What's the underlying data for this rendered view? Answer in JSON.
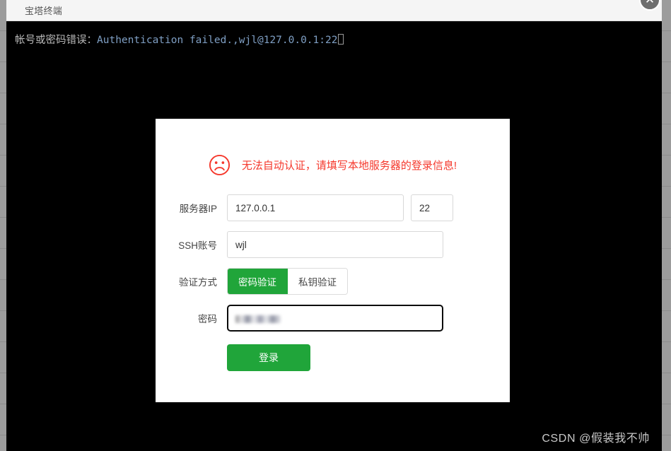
{
  "window": {
    "title": "宝塔终端",
    "close_label": "✕"
  },
  "terminal": {
    "prefix_zh": "帐号或密码错误：",
    "message_en": "Authentication failed.,wjl@127.0.0.1:22",
    "cursor": "",
    "watermark": "CSDN @假装我不帅",
    "background_color": "#000000",
    "zh_text_color": "#b9b9b9",
    "en_text_color": "#7f9fc4"
  },
  "dialog": {
    "alert_icon": "sad-face-icon",
    "alert_text": "无法自动认证，请填写本地服务器的登录信息!",
    "alert_color": "#f5382c",
    "accent_color": "#20a53a",
    "fields": {
      "server_ip": {
        "label": "服务器IP",
        "value": "127.0.0.1",
        "placeholder": "服务器IP"
      },
      "port": {
        "value": "22",
        "placeholder": "22"
      },
      "ssh_user": {
        "label": "SSH账号",
        "value": "wjl",
        "placeholder": "SSH账号"
      },
      "auth_method": {
        "label": "验证方式",
        "options": [
          "密码验证",
          "私钥验证"
        ],
        "selected": "密码验证"
      },
      "password": {
        "label": "密码",
        "value": "••••••••",
        "placeholder": "密码",
        "masked": true,
        "focused": true
      }
    },
    "submit_label": "登录"
  }
}
